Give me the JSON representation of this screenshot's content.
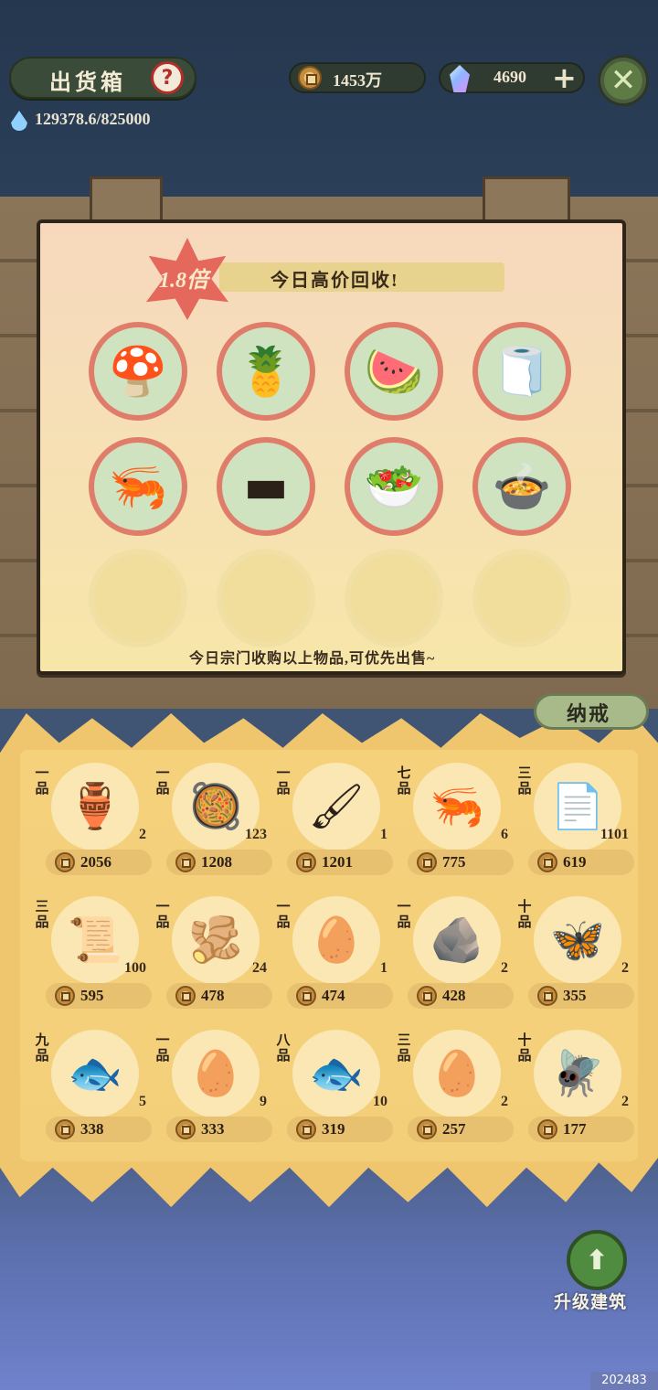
{
  "header": {
    "title": "出货箱",
    "help_symbol": "?",
    "coins": "1453万",
    "jade": "4690",
    "plus_symbol": "+",
    "close_symbol": "✕",
    "capacity": "129378.6/825000"
  },
  "notice": {
    "multiplier": "1.8倍",
    "banner": "今日高价回收!",
    "footer": "今日宗门收购以上物品,可优先出售~",
    "slots": [
      {
        "icon": "mushroom-icon",
        "glyph": "🍄"
      },
      {
        "icon": "pineapple-icon",
        "glyph": "🍍"
      },
      {
        "icon": "watermelon-icon",
        "glyph": "🍉"
      },
      {
        "icon": "silk-roll-icon",
        "glyph": "🧻"
      },
      {
        "icon": "shrimp-on-leaf-icon",
        "glyph": "🦐"
      },
      {
        "icon": "ink-stick-icon",
        "glyph": "▬"
      },
      {
        "icon": "vegetable-dish-icon",
        "glyph": "🥗"
      },
      {
        "icon": "chili-fish-dish-icon",
        "glyph": "🍲"
      }
    ],
    "empty_slots": 4
  },
  "storage": {
    "tab_label": "纳戒",
    "items": [
      {
        "grade": "一品",
        "count": "2",
        "price": "2056",
        "icon": "clay-jar-icon",
        "glyph": "🏺"
      },
      {
        "grade": "一品",
        "count": "123",
        "price": "1208",
        "icon": "stew-pot-icon",
        "glyph": "🥘"
      },
      {
        "grade": "一品",
        "count": "1",
        "price": "1201",
        "icon": "brush-icon",
        "glyph": "🖌"
      },
      {
        "grade": "七品",
        "count": "6",
        "price": "775",
        "icon": "shrimp-on-leaf-icon",
        "glyph": "🦐"
      },
      {
        "grade": "三品",
        "count": "1101",
        "price": "619",
        "icon": "cloth-icon",
        "glyph": "📄"
      },
      {
        "grade": "三品",
        "count": "100",
        "price": "595",
        "icon": "scroll-icon",
        "glyph": "📜"
      },
      {
        "grade": "一品",
        "count": "24",
        "price": "478",
        "icon": "ginger-icon",
        "glyph": "🫚"
      },
      {
        "grade": "一品",
        "count": "1",
        "price": "474",
        "icon": "egg-icon",
        "glyph": "🥚"
      },
      {
        "grade": "一品",
        "count": "2",
        "price": "428",
        "icon": "truffle-icon",
        "glyph": "🪨"
      },
      {
        "grade": "十品",
        "count": "2",
        "price": "355",
        "icon": "butterfly-icon",
        "glyph": "🦋"
      },
      {
        "grade": "九品",
        "count": "5",
        "price": "338",
        "icon": "fish-fillet-icon",
        "glyph": "🐟"
      },
      {
        "grade": "一品",
        "count": "9",
        "price": "333",
        "icon": "blue-egg-icon",
        "glyph": "🥚"
      },
      {
        "grade": "八品",
        "count": "10",
        "price": "319",
        "icon": "fish-fillet-icon",
        "glyph": "🐟"
      },
      {
        "grade": "三品",
        "count": "2",
        "price": "257",
        "icon": "pink-egg-icon",
        "glyph": "🥚"
      },
      {
        "grade": "十品",
        "count": "2",
        "price": "177",
        "icon": "dragonfly-icon",
        "glyph": "🪰"
      }
    ]
  },
  "upgrade": {
    "label": "升级建筑",
    "symbol": "⬆"
  },
  "footer_id": "202483"
}
